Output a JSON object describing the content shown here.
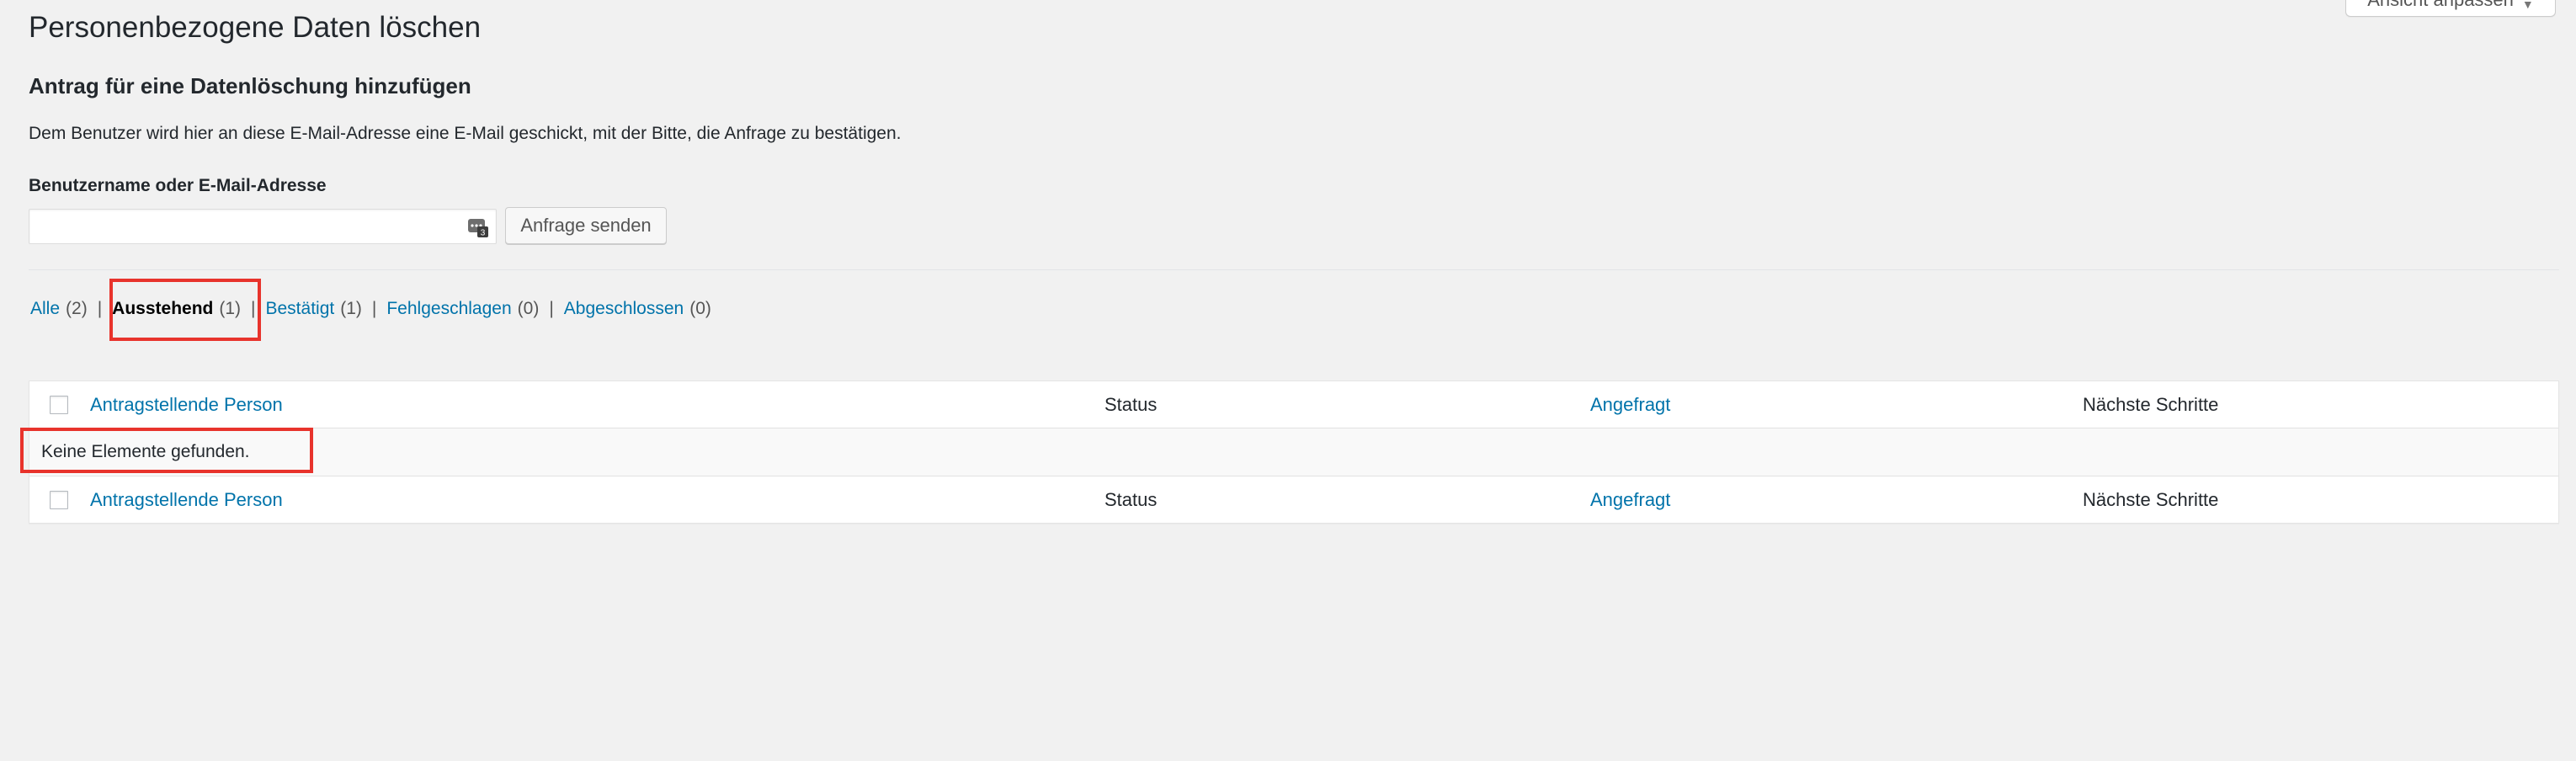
{
  "page": {
    "title": "Personenbezogene Daten löschen",
    "screen_options_label": "Ansicht anpassen"
  },
  "add_request": {
    "heading": "Antrag für eine Datenlöschung hinzufügen",
    "description": "Dem Benutzer wird hier an diese E-Mail-Adresse eine E-Mail geschickt, mit der Bitte, die Anfrage zu bestätigen.",
    "field_label": "Benutzername oder E-Mail-Adresse",
    "field_value": "",
    "submit_label": "Anfrage senden"
  },
  "filters": [
    {
      "label": "Alle",
      "count": "(2)",
      "current": false
    },
    {
      "label": "Ausstehend",
      "count": "(1)",
      "current": true
    },
    {
      "label": "Bestätigt",
      "count": "(1)",
      "current": false
    },
    {
      "label": "Fehlgeschlagen",
      "count": "(0)",
      "current": false
    },
    {
      "label": "Abgeschlossen",
      "count": "(0)",
      "current": false
    }
  ],
  "filter_separator": "|",
  "table": {
    "columns": [
      {
        "label": "Antragstellende Person",
        "sortable": true
      },
      {
        "label": "Status",
        "sortable": false
      },
      {
        "label": "Angefragt",
        "sortable": true
      },
      {
        "label": "Nächste Schritte",
        "sortable": false
      }
    ],
    "empty_message": "Keine Elemente gefunden."
  },
  "colors": {
    "link": "#0073aa",
    "highlight": "#e8332c",
    "background": "#f1f1f1"
  }
}
